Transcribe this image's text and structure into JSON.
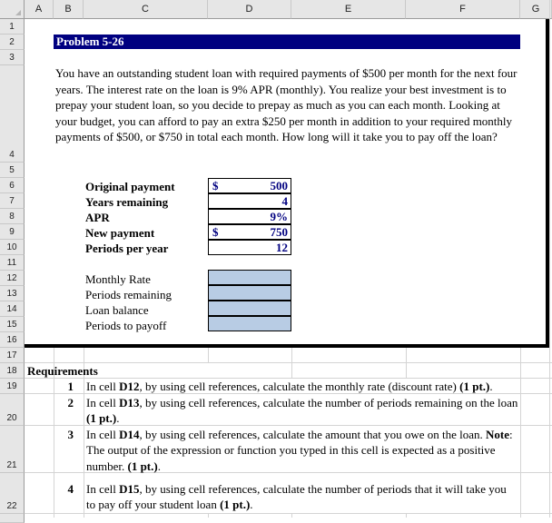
{
  "columns": [
    "A",
    "B",
    "C",
    "D",
    "E",
    "F",
    "G"
  ],
  "rows": [
    "1",
    "2",
    "3",
    "4",
    "5",
    "6",
    "7",
    "8",
    "9",
    "10",
    "11",
    "12",
    "13",
    "14",
    "15",
    "16",
    "17",
    "18",
    "19",
    "20",
    "21",
    "22"
  ],
  "title": "Problem 5-26",
  "problem_text": "You have an outstanding student loan with required payments of $500 per month for the next four years. The interest rate on the loan is 9% APR (monthly). You realize your best investment is to prepay your student loan, so you decide to prepay as much as you can each month. Looking at your budget, you can afford to pay an extra $250 per month in addition to your required monthly payments of $500, or $750 in total each month. How long will it take you to pay off the loan?",
  "inputs": [
    {
      "label": "Original payment",
      "currency": "$",
      "value": "500"
    },
    {
      "label": "Years remaining",
      "currency": "",
      "value": "4"
    },
    {
      "label": "APR",
      "currency": "",
      "value": "9%"
    },
    {
      "label": "New payment",
      "currency": "$",
      "value": "750"
    },
    {
      "label": "Periods per year",
      "currency": "",
      "value": "12"
    }
  ],
  "outputs": [
    {
      "label": "Monthly Rate",
      "value": ""
    },
    {
      "label": "Periods remaining",
      "value": ""
    },
    {
      "label": "Loan balance",
      "value": ""
    },
    {
      "label": "Periods to payoff",
      "value": ""
    }
  ],
  "requirements_heading": "Requirements",
  "requirements": [
    {
      "num": "1",
      "pre": "In cell ",
      "cell": "D12",
      "post": ", by using cell references, calculate the  monthly rate (discount rate) ",
      "pts": "(1 pt.)",
      "end": "."
    },
    {
      "num": "2",
      "pre": "In cell ",
      "cell": "D13",
      "post": ", by using cell references, calculate the number of periods remaining on the loan ",
      "pts": "(1 pt.)",
      "end": "."
    },
    {
      "num": "3",
      "pre": "In cell ",
      "cell": "D14",
      "post": ", by using cell references, calculate the amount that you owe on the loan. ",
      "note_label": "Note",
      "note": ": The output of the expression or function you typed in this cell is expected as a positive number. ",
      "pts": "(1 pt.)",
      "end": "."
    },
    {
      "num": "4",
      "pre": "In cell ",
      "cell": "D15",
      "post": ", by using cell references, calculate the number of periods that it will take you to pay off your student loan ",
      "pts": "(1 pt.)",
      "end": "."
    }
  ],
  "colors": {
    "title_bar": "#000080",
    "input_text": "#000080",
    "output_fill": "#b8cce4"
  }
}
